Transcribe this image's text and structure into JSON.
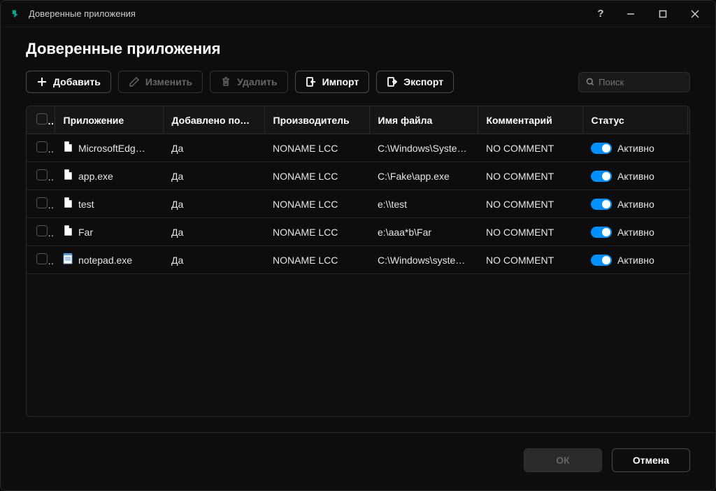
{
  "titlebar": {
    "title": "Доверенные приложения"
  },
  "heading": "Доверенные приложения",
  "toolbar": {
    "add": "Добавить",
    "edit": "Изменить",
    "delete": "Удалить",
    "import": "Импорт",
    "export": "Экспорт"
  },
  "search": {
    "placeholder": "Поиск"
  },
  "columns": {
    "app": "Приложение",
    "added": "Добавлено польз…",
    "mfr": "Производитель",
    "file": "Имя файла",
    "comment": "Комментарий",
    "status": "Статус"
  },
  "status_active_label": "Активно",
  "rows": [
    {
      "app": "MicrosoftEdg…",
      "icon": "file",
      "added": "Да",
      "mfr": "NONAME LCC",
      "file": "C:\\Windows\\System…",
      "comment": "NO COMMENT"
    },
    {
      "app": "app.exe",
      "icon": "file",
      "added": "Да",
      "mfr": "NONAME LCC",
      "file": "C:\\Fake\\app.exe",
      "comment": "NO COMMENT"
    },
    {
      "app": "test",
      "icon": "file",
      "added": "Да",
      "mfr": "NONAME LCC",
      "file": "e:\\\\test",
      "comment": "NO COMMENT"
    },
    {
      "app": "Far",
      "icon": "file",
      "added": "Да",
      "mfr": "NONAME LCC",
      "file": "e:\\aaa*b\\Far",
      "comment": "NO COMMENT"
    },
    {
      "app": "notepad.exe",
      "icon": "notepad",
      "added": "Да",
      "mfr": "NONAME LCC",
      "file": "C:\\Windows\\system…",
      "comment": "NO COMMENT"
    }
  ],
  "footer": {
    "ok": "ОК",
    "cancel": "Отмена"
  }
}
